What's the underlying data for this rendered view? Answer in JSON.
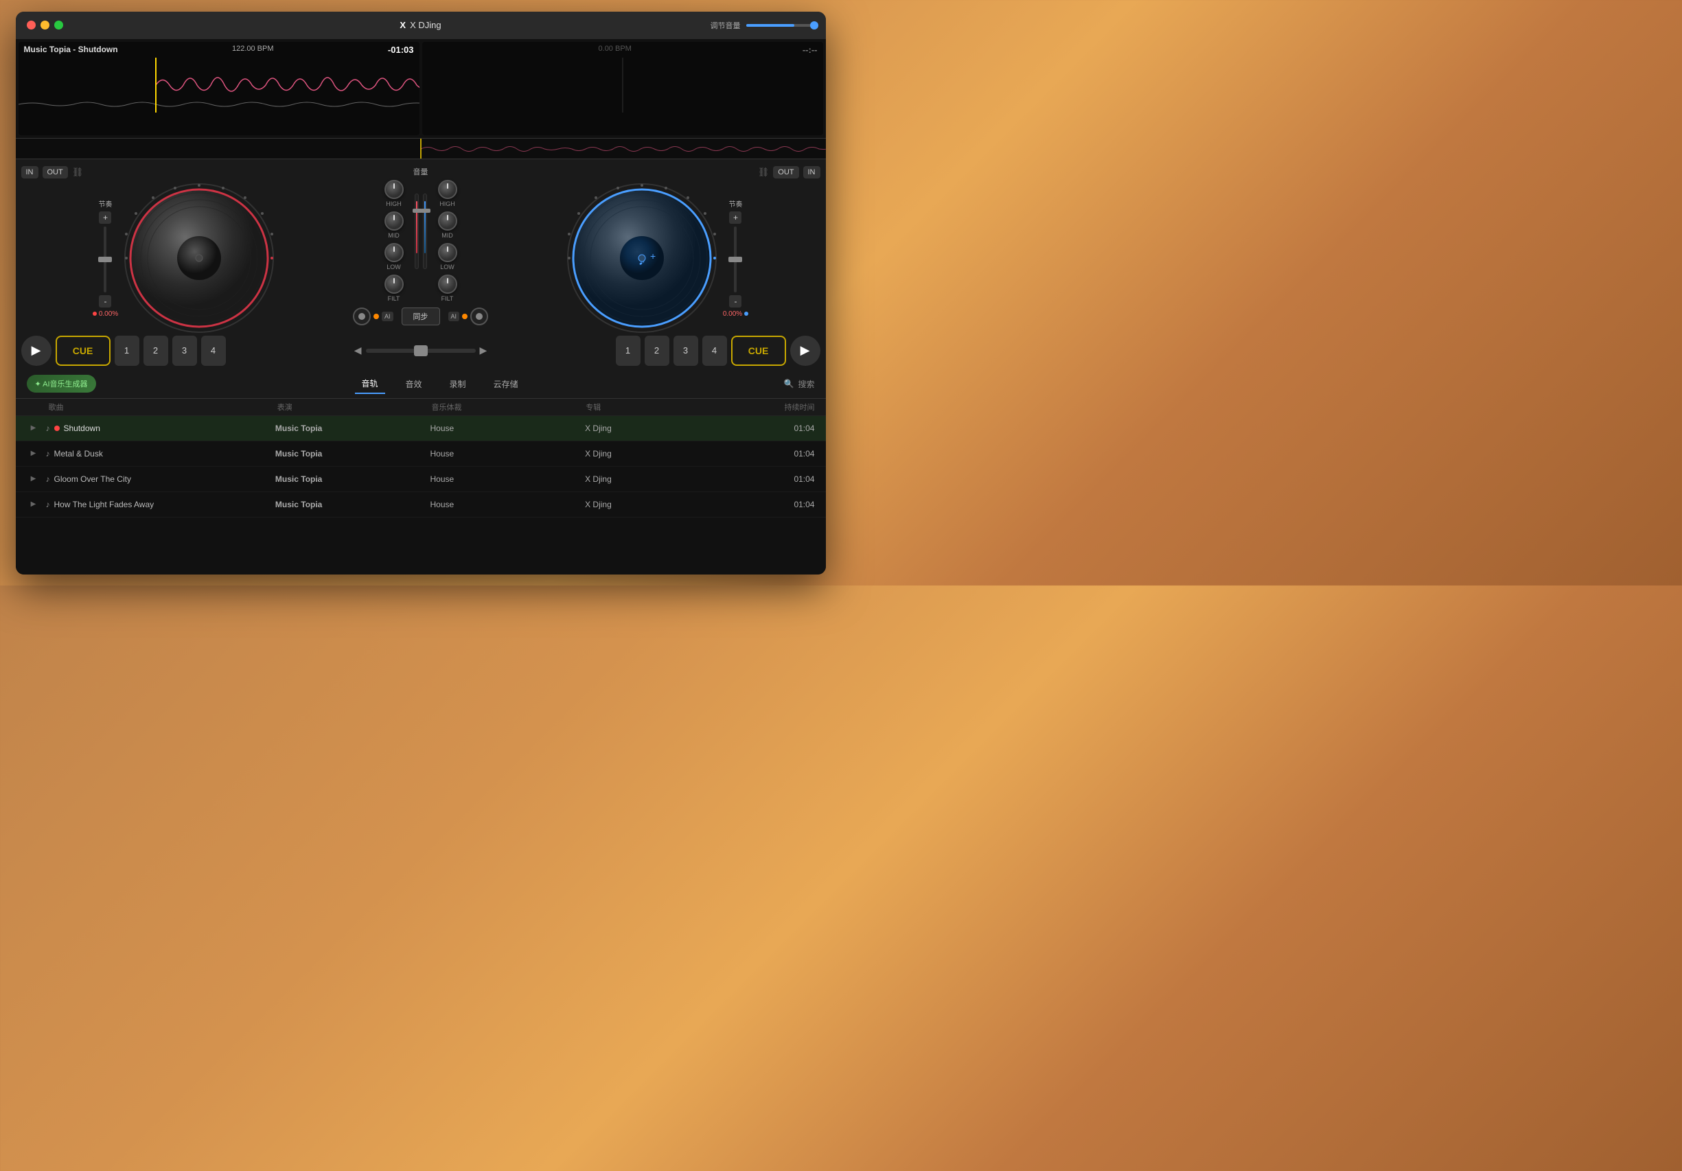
{
  "app": {
    "title": "X DJing",
    "volume_label": "调节音量"
  },
  "left_deck": {
    "track": "Music Topia - Shutdown",
    "bpm": "122.00 BPM",
    "time": "-01:03",
    "in_label": "IN",
    "out_label": "OUT",
    "tempo_label": "节奏",
    "tempo_value": "0.00%",
    "cue_label": "CUE",
    "hot_cues": [
      "1",
      "2",
      "3",
      "4"
    ]
  },
  "right_deck": {
    "bpm": "0.00 BPM",
    "time": "--:--",
    "in_label": "IN",
    "out_label": "OUT",
    "tempo_label": "节奏",
    "tempo_value": "0.00%",
    "cue_label": "CUE",
    "hot_cues": [
      "1",
      "2",
      "3",
      "4"
    ]
  },
  "mixer": {
    "volume_label": "音量",
    "sync_label": "同步",
    "high_label": "HIGH",
    "mid_label": "MID",
    "low_label": "LOW",
    "filt_label": "FILT"
  },
  "library": {
    "ai_btn_label": "✦ AI音乐生成器",
    "tabs": [
      "音轨",
      "音效",
      "录制",
      "云存储"
    ],
    "active_tab": "音轨",
    "search_placeholder": "搜索",
    "columns": {
      "song": "歌曲",
      "artist": "表演",
      "genre": "音乐体裁",
      "album": "专辑",
      "duration": "持续时间"
    },
    "tracks": [
      {
        "name": "Shutdown",
        "artist": "Music Topia",
        "genre": "House",
        "album": "X Djing",
        "duration": "01:04",
        "active": true
      },
      {
        "name": "Metal & Dusk",
        "artist": "Music Topia",
        "genre": "House",
        "album": "X Djing",
        "duration": "01:04",
        "active": false
      },
      {
        "name": "Gloom Over The City",
        "artist": "Music Topia",
        "genre": "House",
        "album": "X Djing",
        "duration": "01:04",
        "active": false
      },
      {
        "name": "How The Light Fades Away",
        "artist": "Music Topia",
        "genre": "House",
        "album": "X Djing",
        "duration": "01:04",
        "active": false
      }
    ]
  }
}
